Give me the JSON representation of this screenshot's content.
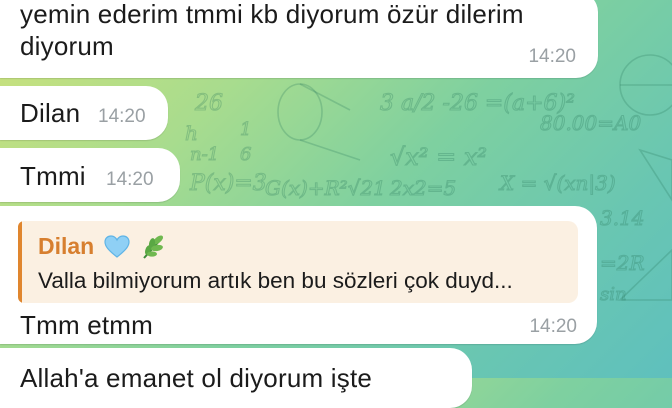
{
  "messages": [
    {
      "text": "yemin ederim tmmi kb diyorum özür dilerim diyorum",
      "time": "14:20"
    },
    {
      "text": "Dilan",
      "time": "14:20"
    },
    {
      "text": "Tmmi",
      "time": "14:20"
    },
    {
      "reply": {
        "name": "Dilan",
        "emoji": [
          "blue-heart",
          "herb"
        ],
        "text": "Valla bilmiyorum artık ben bu sözleri çok duyd..."
      },
      "text": "Tmm etmm",
      "time": "14:20"
    },
    {
      "text": "Allah'a emanet ol diyorum işte"
    }
  ],
  "colors": {
    "bubble": "#ffffff",
    "reply_accent": "#e0862e",
    "reply_background": "#fbf0e2",
    "time": "#9aa0a4"
  }
}
